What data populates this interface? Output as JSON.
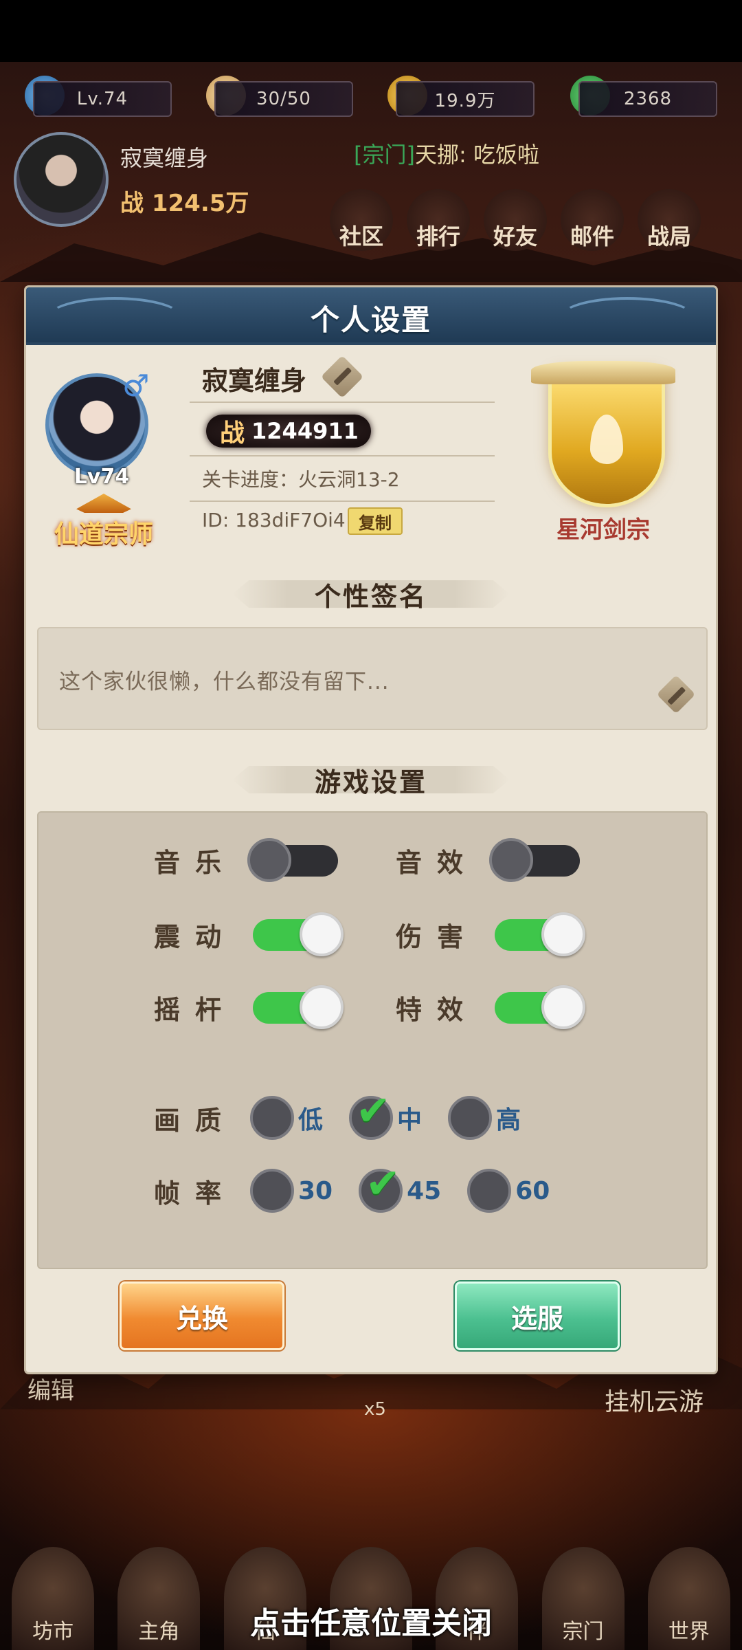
{
  "hud": {
    "level": "Lv.74",
    "stamina": "30/50",
    "coins": "19.9万",
    "jade": "2368",
    "player_name": "寂寞缠身",
    "player_power_prefix": "战",
    "player_power": "124.5万",
    "chat_tag": "[宗门]",
    "chat_text": "天挪: 吃饭啦",
    "menu": [
      "社区",
      "排行",
      "好友",
      "邮件",
      "战局"
    ],
    "bottom_nav": [
      "坊市",
      "主角",
      "仙",
      "",
      "伴",
      "宗门",
      "世界"
    ],
    "side_labels": [
      "挂机云游",
      "编辑",
      "x5"
    ]
  },
  "dialog": {
    "title": "个人设置",
    "profile": {
      "name": "寂寞缠身",
      "gender_symbol": "♂",
      "level": "Lv74",
      "rank_title": "仙道宗师",
      "power_prefix": "战",
      "power": "1244911",
      "progress_label": "关卡进度：火云洞13-2",
      "id_label": "ID: 183diF7Oi4",
      "copy_label": "复制",
      "sect_name": "星河剑宗"
    },
    "signature": {
      "heading": "个性签名",
      "text": "这个家伙很懒，什么都没有留下..."
    },
    "game_settings": {
      "heading": "游戏设置",
      "toggles": [
        {
          "label": "音乐",
          "on": false
        },
        {
          "label": "音效",
          "on": false
        },
        {
          "label": "震动",
          "on": true
        },
        {
          "label": "伤害",
          "on": true
        },
        {
          "label": "摇杆",
          "on": true
        },
        {
          "label": "特效",
          "on": true
        }
      ],
      "quality": {
        "label": "画质",
        "options": [
          "低",
          "中",
          "高"
        ],
        "selected": "中"
      },
      "framerate": {
        "label": "帧率",
        "options": [
          "30",
          "45",
          "60"
        ],
        "selected": "45"
      }
    },
    "buttons": {
      "redeem": "兑换",
      "outfit": "选服"
    }
  },
  "close_hint": "点击任意位置关闭",
  "colors": {
    "toggle_on": "#3ec64a",
    "toggle_off": "#2f2f33",
    "header": "#2a4a68",
    "sect_red": "#a83a30"
  }
}
